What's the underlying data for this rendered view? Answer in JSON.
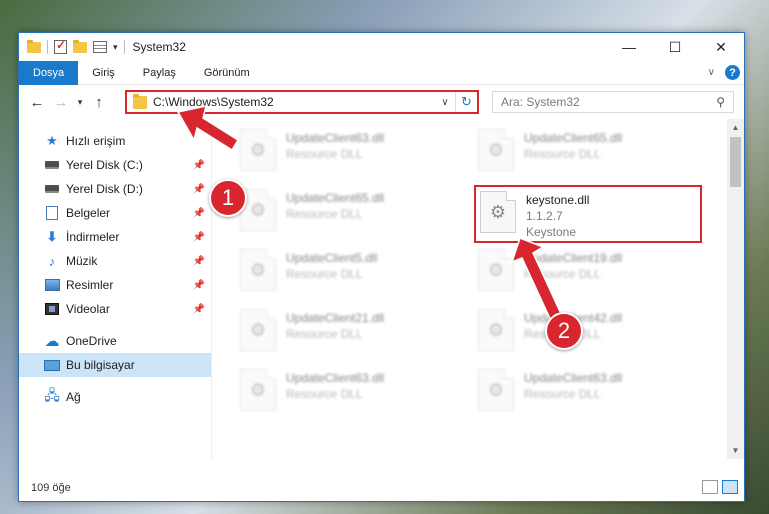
{
  "window": {
    "title": "System32"
  },
  "ribbon": {
    "tabs": [
      "Dosya",
      "Giriş",
      "Paylaş",
      "Görünüm"
    ],
    "help_label": "?"
  },
  "navbar": {
    "address": "C:\\Windows\\System32",
    "search_placeholder": "Ara: System32"
  },
  "sidebar": {
    "items": [
      {
        "label": "Hızlı erişim",
        "icon": "star-icon"
      },
      {
        "label": "Yerel Disk (C:)",
        "icon": "drive-icon",
        "pinned": true
      },
      {
        "label": "Yerel Disk (D:)",
        "icon": "drive-icon",
        "pinned": true
      },
      {
        "label": "Belgeler",
        "icon": "document-icon",
        "pinned": true
      },
      {
        "label": "İndirmeler",
        "icon": "download-icon",
        "pinned": true
      },
      {
        "label": "Müzik",
        "icon": "music-icon",
        "pinned": true
      },
      {
        "label": "Resimler",
        "icon": "pictures-icon",
        "pinned": true
      },
      {
        "label": "Videolar",
        "icon": "video-icon",
        "pinned": true
      },
      {
        "label": "OneDrive",
        "icon": "cloud-icon"
      },
      {
        "label": "Bu bilgisayar",
        "icon": "computer-icon",
        "selected": true
      },
      {
        "label": "Ağ",
        "icon": "network-icon"
      }
    ]
  },
  "files": [
    {
      "name": "UpdateClient63.dll",
      "sub": "Resource DLL"
    },
    {
      "name": "UpdateClient65.dll",
      "sub": "Resource DLL"
    },
    {
      "name": "UpdateClient65.dll",
      "sub": "Resource DLL"
    },
    {
      "name": "keystone.dll",
      "version": "1.1.2.7",
      "sub": "Keystone"
    },
    {
      "name": "UpdateClient5.dll",
      "sub": "Resource DLL"
    },
    {
      "name": "UpdateClient19.dll",
      "sub": "Resource DLL"
    },
    {
      "name": "UpdateClient21.dll",
      "sub": "Resource DLL"
    },
    {
      "name": "UpdateClient42.dll",
      "sub": "Resource DLL"
    },
    {
      "name": "UpdateClient63.dll",
      "sub": "Resource DLL"
    },
    {
      "name": "UpdateClient63.dll",
      "sub": "Resource DLL"
    }
  ],
  "status": {
    "item_count": "109 öğe"
  },
  "annotations": {
    "step1": "1",
    "step2": "2"
  },
  "colors": {
    "accent": "#1979ca",
    "highlight": "#d8262e",
    "selected": "#cce4f7"
  }
}
